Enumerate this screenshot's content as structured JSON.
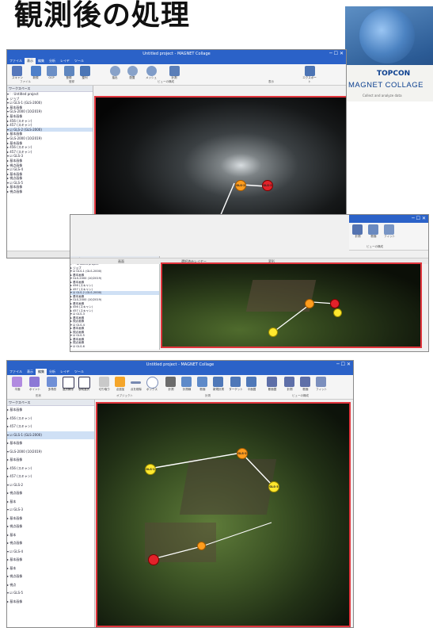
{
  "page": {
    "title": "観測後の処理"
  },
  "logo": {
    "brand": "TOPCON",
    "product": "MAGNET COLLAGE",
    "tagline": "Collect and analyze data"
  },
  "win1": {
    "title": "Untitled project - MAGNET Collage",
    "tabs": [
      "ファイル",
      "表示",
      "編集",
      "分析",
      "レイヤ",
      "ツール"
    ],
    "ribbon": [
      "スキャン",
      "新規",
      "GCP",
      "登録",
      "整列",
      "抽出",
      "配置",
      "メッシュ",
      "計測",
      "エクスポート"
    ],
    "groups": [
      "ファイル",
      "登録",
      "ビューの構成",
      "表示"
    ],
    "panel_header": "ワークスペース",
    "tree": [
      "▾ 🗀 Untitled project",
      "  ▸ ジョブ",
      "  ▾ ☑ GLS-1 (GLS-2000)",
      "     ▸ 基本画像",
      "     ▾ GLS-2000 (10/2019)",
      "        ▸ 基本画像",
      "        ▸ 456 (スキャン)",
      "        ▸ 457 (スキャン)",
      "  ▾ ☑ GLS-2 (GLS-2000)",
      "     ▸ 基本画像",
      "     ▾ GLS-2000 (10/2019)",
      "        ▸ 基本画像",
      "        ▸ 456 (スキャン)",
      "        ▸ 457 (スキャン)",
      "  ▾ ☑ GLS-3",
      "     ▸ 基本画像",
      "     ▸ 視点画像",
      "  ▾ ☑ GLS-4",
      "     ▸ 基本画像",
      "     ▸ 視点画像",
      "  ▾ ☑ GLS-5",
      "     ▸ 基本画像",
      "     ▸ 視点画像"
    ],
    "status": [
      "画面",
      "選択済みレイヤー",
      "変形"
    ],
    "markers": {
      "a": "GLS-1",
      "b": "GLS-2",
      "c": "GLS-3"
    }
  },
  "win2": {
    "ribbon": [
      "計測",
      "断面",
      "フィット"
    ],
    "group": "ビューの構成",
    "panel_header": "ワークスペース",
    "tree": [
      "▾ 🗀 Untitled project",
      "  ▸ ジョブ",
      "  ▾ ☑ GLS-1 (GLS-2000)",
      "     ▸ 基本画像",
      "     ▾ GLS-2000 (10/2019)",
      "        ▸ 基本画像",
      "        ▸ 456 (スキャン)",
      "        ▸ 457 (スキャン)",
      "  ▾ ☑ GLS-2 (GLS-2000)",
      "     ▸ 基本画像",
      "     ▾ GLS-2000 (10/2019)",
      "        ▸ 基本画像",
      "        ▸ 456 (スキャン)",
      "        ▸ 457 (スキャン)",
      "  ▾ ☑ GLS-3",
      "     ▸ 基本画像",
      "     ▸ 視点画像",
      "  ▾ ☑ GLS-4",
      "     ▸ 基本画像",
      "     ▸ 視点画像",
      "  ▾ ☑ GLS-5",
      "     ▸ 基本画像",
      "     ▸ 視点画像",
      "  ▾ ☑ GLS-6"
    ],
    "status": [
      "画面",
      "選択済みレイヤー",
      "変形"
    ]
  },
  "win3": {
    "title": "Untitled project - MAGNET Collage",
    "tabs": [
      "ファイル",
      "表示",
      "編集",
      "分析",
      "レイヤ",
      "ツール"
    ],
    "ribbon": [
      "平面",
      "ポイント",
      "多角形",
      "選択解除",
      "領域選択",
      "切り取り",
      "点追加",
      "点を削除",
      "ボックス",
      "計測",
      "計測線",
      "断面",
      "新規計測",
      "ターゲット",
      "平面図",
      "断面図",
      "計測",
      "断面",
      "フィット"
    ],
    "groups": [
      "形状",
      "オブジェクト",
      "計測",
      "ビューの構成"
    ],
    "panel_header": "ワークスペース",
    "tree": [
      "  ▸ 基本画像",
      "  ▸ 456 (スキャン)",
      "  ▸ 457 (スキャン)",
      "▾ ☑ GLS-1 (GLS-2000)",
      "  ▸ 基本画像",
      "  ▾ GLS-2000 (10/2019)",
      "     ▸ 基本画像",
      "     ▸ 456 (スキャン)",
      "     ▸ 457 (スキャン)",
      "▾ ☑ GLS-2",
      "  ▸ 視点画像",
      "  ▸ 基本",
      "▾ ☑ GLS-3",
      "  ▸ 基本画像",
      "  ▸ 視点画像",
      "  ▸ 基本",
      "  ▸ 視点画像",
      "▾ ☑ GLS-4",
      "  ▸ 基本画像",
      "  ▸ 基本",
      "  ▸ 視点画像",
      "  ▸ 視点",
      "▾ ☑ GLS-5",
      "  ▸ 基本画像"
    ],
    "markers": {
      "a": "GLS-1",
      "b": "GLS-2",
      "c": "GLS-3"
    }
  },
  "colors": {
    "accent": "#2b62c8",
    "viewport_border": "#e0343c",
    "marker_yellow": "#ffe82e",
    "marker_red": "#e2222a",
    "marker_orange": "#ff9d1e"
  }
}
